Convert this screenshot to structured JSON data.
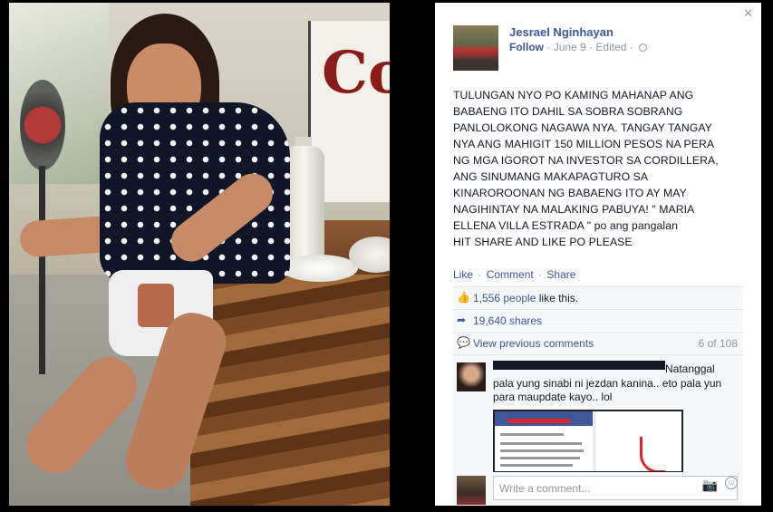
{
  "post": {
    "author": "Jesrael Nginhayan",
    "follow": "Follow",
    "date": "June 9",
    "edited": "Edited",
    "dot": "·",
    "text": "TULUNGAN NYO PO KAMING MAHANAP ANG\nBABAENG ITO DAHIL SA SOBRA SOBRANG\nPANLOLOKONG NAGAWA NYA. TANGAY TANGAY\nNYA ANG MAHIGIT 150 MILLION PESOS NA PERA\nNG MGA IGOROT NA INVESTOR SA CORDILLERA,\nANG SINUMANG MAKAPAGTURO SA\nKINAROROONAN NG BABAENG ITO AY MAY\nNAGIHINTAY NA MALAKING PABUYA! \" MARIA\nELLENA VILLA ESTRADA \" po ang pangalan\nHIT SHARE AND LIKE PO PLEASE",
    "actions": [
      "Like",
      "Comment",
      "Share"
    ]
  },
  "stats": {
    "likes_count": "1,556 people",
    "likes_suffix": " like this.",
    "shares": "19,640 shares",
    "view_previous": "View previous comments",
    "comment_count": "6 of 108"
  },
  "comment": {
    "text": "Natanggal pala yung sinabi ni jezdan kanina.. eto pala yun para maupdate kayo.. lol"
  },
  "composer": {
    "placeholder": "Write a comment..."
  },
  "photo": {
    "poster_text": "Co"
  },
  "icons": {
    "close": "close-icon",
    "globe": "globe-icon",
    "like": "thumbs-up-icon",
    "share": "share-arrow-icon",
    "comment": "comment-bubble-icon",
    "camera": "camera-icon",
    "emoji": "smiley-icon"
  },
  "colors": {
    "link": "#3b5998",
    "meta": "#9197a3",
    "text": "#141823",
    "background": "#000000"
  }
}
